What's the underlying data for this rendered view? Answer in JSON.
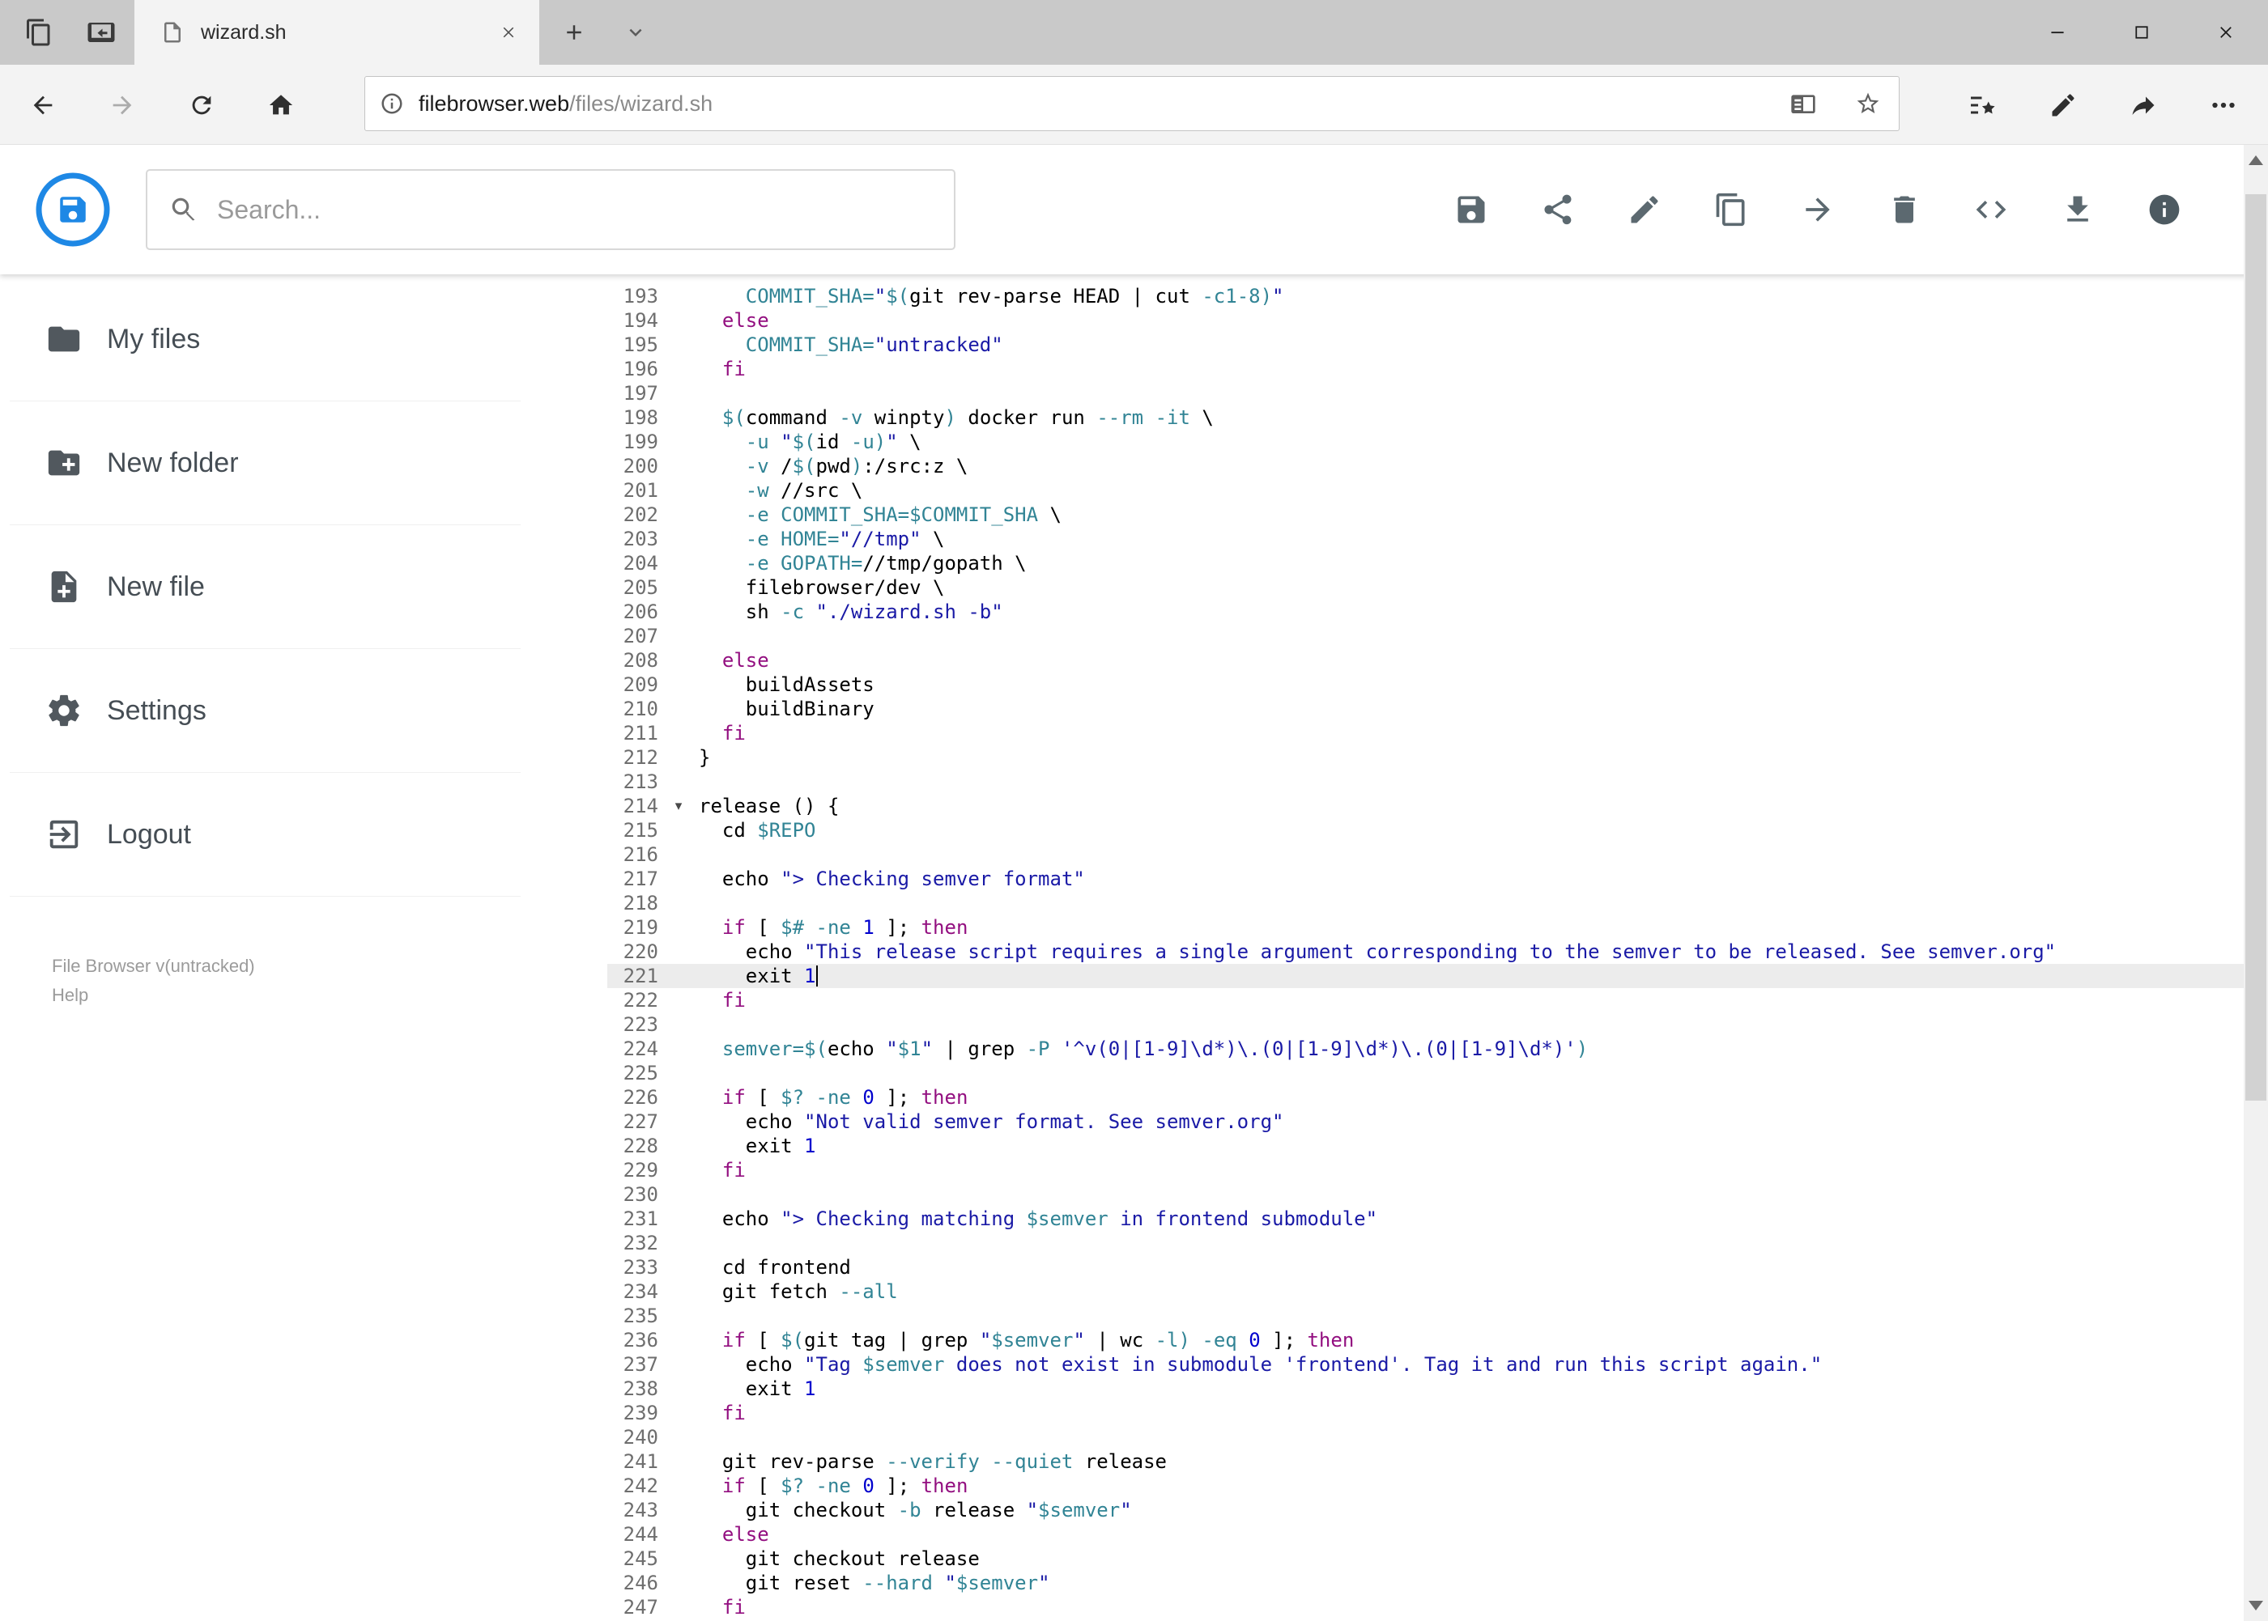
{
  "browser": {
    "tab": {
      "title": "wizard.sh"
    },
    "window_controls": [
      "minimize",
      "maximize",
      "close"
    ],
    "strip_icons": [
      "tabs-aside-icon",
      "tabs-preview-icon",
      "new-tab-icon",
      "tab-list-chevron-icon"
    ],
    "nav_icons": [
      "back-icon",
      "forward-icon",
      "refresh-icon",
      "home-icon"
    ],
    "address": {
      "host": "filebrowser.web",
      "path": "/files/wizard.sh"
    },
    "address_icons": [
      "page-info-icon",
      "reading-view-icon",
      "favorite-star-icon"
    ],
    "hub_icons": [
      "favorites-hub-icon",
      "annotate-pen-icon",
      "share-icon",
      "more-options-icon"
    ]
  },
  "app": {
    "accent_color": "#1e88e5",
    "search": {
      "placeholder": "Search..."
    },
    "toolbar": {
      "icons": [
        "save",
        "share",
        "rename",
        "copy",
        "move",
        "delete",
        "code",
        "download",
        "info"
      ]
    },
    "sidebar": {
      "items": [
        {
          "label": "My files",
          "icon": "folder-icon"
        },
        {
          "label": "New folder",
          "icon": "new-folder-icon"
        },
        {
          "label": "New file",
          "icon": "new-file-icon"
        },
        {
          "label": "Settings",
          "icon": "settings-gear-icon"
        },
        {
          "label": "Logout",
          "icon": "logout-icon"
        }
      ],
      "footer": {
        "version": "File Browser v(untracked)",
        "help": "Help"
      }
    }
  },
  "editor": {
    "first_line": 193,
    "active_line": 221,
    "fold_line": 214,
    "colors": {
      "keyword": "#930F80",
      "string": "#1A1AA6",
      "variable": "#318495",
      "numeric": "#0000CD",
      "default": "#000000"
    },
    "lines": [
      {
        "n": 193,
        "t": [
          [
            "    ",
            "d"
          ],
          [
            "COMMIT_SHA=",
            "v"
          ],
          [
            "\"",
            "s"
          ],
          [
            "$(",
            "v"
          ],
          [
            "git rev-parse HEAD | cut ",
            "d"
          ],
          [
            "-c1-8",
            "v"
          ],
          [
            ")",
            "v"
          ],
          [
            "\"",
            "s"
          ]
        ]
      },
      {
        "n": 194,
        "t": [
          [
            "  ",
            "d"
          ],
          [
            "else",
            "k"
          ]
        ]
      },
      {
        "n": 195,
        "t": [
          [
            "    ",
            "d"
          ],
          [
            "COMMIT_SHA=",
            "v"
          ],
          [
            "\"untracked\"",
            "s"
          ]
        ]
      },
      {
        "n": 196,
        "t": [
          [
            "  ",
            "d"
          ],
          [
            "fi",
            "k"
          ]
        ]
      },
      {
        "n": 197,
        "t": []
      },
      {
        "n": 198,
        "t": [
          [
            "  ",
            "d"
          ],
          [
            "$(",
            "v"
          ],
          [
            "command ",
            "d"
          ],
          [
            "-v",
            "v"
          ],
          [
            " winpty",
            "d"
          ],
          [
            ")",
            "v"
          ],
          [
            " docker run ",
            "d"
          ],
          [
            "--rm",
            "v"
          ],
          [
            " ",
            "d"
          ],
          [
            "-it",
            "v"
          ],
          [
            " \\",
            "d"
          ]
        ]
      },
      {
        "n": 199,
        "t": [
          [
            "    ",
            "d"
          ],
          [
            "-u",
            "v"
          ],
          [
            " ",
            "d"
          ],
          [
            "\"",
            "s"
          ],
          [
            "$(",
            "v"
          ],
          [
            "id ",
            "d"
          ],
          [
            "-u",
            "v"
          ],
          [
            ")",
            "v"
          ],
          [
            "\"",
            "s"
          ],
          [
            " \\",
            "d"
          ]
        ]
      },
      {
        "n": 200,
        "t": [
          [
            "    ",
            "d"
          ],
          [
            "-v",
            "v"
          ],
          [
            " /",
            "d"
          ],
          [
            "$(",
            "v"
          ],
          [
            "pwd",
            "d"
          ],
          [
            ")",
            "v"
          ],
          [
            ":/src:z \\",
            "d"
          ]
        ]
      },
      {
        "n": 201,
        "t": [
          [
            "    ",
            "d"
          ],
          [
            "-w",
            "v"
          ],
          [
            " //src \\",
            "d"
          ]
        ]
      },
      {
        "n": 202,
        "t": [
          [
            "    ",
            "d"
          ],
          [
            "-e",
            "v"
          ],
          [
            " ",
            "d"
          ],
          [
            "COMMIT_SHA=$COMMIT_SHA",
            "v"
          ],
          [
            " \\",
            "d"
          ]
        ]
      },
      {
        "n": 203,
        "t": [
          [
            "    ",
            "d"
          ],
          [
            "-e",
            "v"
          ],
          [
            " ",
            "d"
          ],
          [
            "HOME=",
            "v"
          ],
          [
            "\"//tmp\"",
            "s"
          ],
          [
            " \\",
            "d"
          ]
        ]
      },
      {
        "n": 204,
        "t": [
          [
            "    ",
            "d"
          ],
          [
            "-e",
            "v"
          ],
          [
            " ",
            "d"
          ],
          [
            "GOPATH=",
            "v"
          ],
          [
            "//tmp/gopath \\",
            "d"
          ]
        ]
      },
      {
        "n": 205,
        "t": [
          [
            "    filebrowser/dev \\",
            "d"
          ]
        ]
      },
      {
        "n": 206,
        "t": [
          [
            "    sh ",
            "d"
          ],
          [
            "-c",
            "v"
          ],
          [
            " ",
            "d"
          ],
          [
            "\"./wizard.sh -b\"",
            "s"
          ]
        ]
      },
      {
        "n": 207,
        "t": []
      },
      {
        "n": 208,
        "t": [
          [
            "  ",
            "d"
          ],
          [
            "else",
            "k"
          ]
        ]
      },
      {
        "n": 209,
        "t": [
          [
            "    buildAssets",
            "d"
          ]
        ]
      },
      {
        "n": 210,
        "t": [
          [
            "    buildBinary",
            "d"
          ]
        ]
      },
      {
        "n": 211,
        "t": [
          [
            "  ",
            "d"
          ],
          [
            "fi",
            "k"
          ]
        ]
      },
      {
        "n": 212,
        "t": [
          [
            "}",
            "d"
          ]
        ]
      },
      {
        "n": 213,
        "t": []
      },
      {
        "n": 214,
        "t": [
          [
            "release () {",
            "d"
          ]
        ]
      },
      {
        "n": 215,
        "t": [
          [
            "  cd ",
            "d"
          ],
          [
            "$REPO",
            "v"
          ]
        ]
      },
      {
        "n": 216,
        "t": []
      },
      {
        "n": 217,
        "t": [
          [
            "  echo ",
            "d"
          ],
          [
            "\"> Checking semver format\"",
            "s"
          ]
        ]
      },
      {
        "n": 218,
        "t": []
      },
      {
        "n": 219,
        "t": [
          [
            "  ",
            "d"
          ],
          [
            "if",
            "k"
          ],
          [
            " [ ",
            "d"
          ],
          [
            "$#",
            "v"
          ],
          [
            " ",
            "d"
          ],
          [
            "-ne",
            "v"
          ],
          [
            " ",
            "d"
          ],
          [
            "1",
            "n"
          ],
          [
            " ]; ",
            "d"
          ],
          [
            "then",
            "k"
          ]
        ]
      },
      {
        "n": 220,
        "t": [
          [
            "    echo ",
            "d"
          ],
          [
            "\"This release script requires a single argument corresponding to the semver to be released. See semver.org\"",
            "s"
          ]
        ]
      },
      {
        "n": 221,
        "t": [
          [
            "    exit ",
            "d"
          ],
          [
            "1",
            "n"
          ]
        ]
      },
      {
        "n": 222,
        "t": [
          [
            "  ",
            "d"
          ],
          [
            "fi",
            "k"
          ]
        ]
      },
      {
        "n": 223,
        "t": []
      },
      {
        "n": 224,
        "t": [
          [
            "  ",
            "d"
          ],
          [
            "semver=$(",
            "v"
          ],
          [
            "echo ",
            "d"
          ],
          [
            "\"",
            "s"
          ],
          [
            "$1",
            "v"
          ],
          [
            "\"",
            "s"
          ],
          [
            " | grep ",
            "d"
          ],
          [
            "-P",
            "v"
          ],
          [
            " ",
            "d"
          ],
          [
            "'^v(0|[1-9]\\d*)\\.(0|[1-9]\\d*)\\.(0|[1-9]\\d*)'",
            "s"
          ],
          [
            ")",
            "v"
          ]
        ]
      },
      {
        "n": 225,
        "t": []
      },
      {
        "n": 226,
        "t": [
          [
            "  ",
            "d"
          ],
          [
            "if",
            "k"
          ],
          [
            " [ ",
            "d"
          ],
          [
            "$?",
            "v"
          ],
          [
            " ",
            "d"
          ],
          [
            "-ne",
            "v"
          ],
          [
            " ",
            "d"
          ],
          [
            "0",
            "n"
          ],
          [
            " ]; ",
            "d"
          ],
          [
            "then",
            "k"
          ]
        ]
      },
      {
        "n": 227,
        "t": [
          [
            "    echo ",
            "d"
          ],
          [
            "\"Not valid semver format. See semver.org\"",
            "s"
          ]
        ]
      },
      {
        "n": 228,
        "t": [
          [
            "    exit ",
            "d"
          ],
          [
            "1",
            "n"
          ]
        ]
      },
      {
        "n": 229,
        "t": [
          [
            "  ",
            "d"
          ],
          [
            "fi",
            "k"
          ]
        ]
      },
      {
        "n": 230,
        "t": []
      },
      {
        "n": 231,
        "t": [
          [
            "  echo ",
            "d"
          ],
          [
            "\"> Checking matching ",
            "s"
          ],
          [
            "$semver",
            "v"
          ],
          [
            " in frontend submodule\"",
            "s"
          ]
        ]
      },
      {
        "n": 232,
        "t": []
      },
      {
        "n": 233,
        "t": [
          [
            "  cd frontend",
            "d"
          ]
        ]
      },
      {
        "n": 234,
        "t": [
          [
            "  git fetch ",
            "d"
          ],
          [
            "--all",
            "v"
          ]
        ]
      },
      {
        "n": 235,
        "t": []
      },
      {
        "n": 236,
        "t": [
          [
            "  ",
            "d"
          ],
          [
            "if",
            "k"
          ],
          [
            " [ ",
            "d"
          ],
          [
            "$(",
            "v"
          ],
          [
            "git tag | grep ",
            "d"
          ],
          [
            "\"",
            "s"
          ],
          [
            "$semver",
            "v"
          ],
          [
            "\"",
            "s"
          ],
          [
            " | wc ",
            "d"
          ],
          [
            "-l",
            "v"
          ],
          [
            ")",
            "v"
          ],
          [
            " ",
            "d"
          ],
          [
            "-eq",
            "v"
          ],
          [
            " ",
            "d"
          ],
          [
            "0",
            "n"
          ],
          [
            " ]; ",
            "d"
          ],
          [
            "then",
            "k"
          ]
        ]
      },
      {
        "n": 237,
        "t": [
          [
            "    echo ",
            "d"
          ],
          [
            "\"Tag ",
            "s"
          ],
          [
            "$semver",
            "v"
          ],
          [
            " does not exist in submodule 'frontend'. Tag it and run this script again.\"",
            "s"
          ]
        ]
      },
      {
        "n": 238,
        "t": [
          [
            "    exit ",
            "d"
          ],
          [
            "1",
            "n"
          ]
        ]
      },
      {
        "n": 239,
        "t": [
          [
            "  ",
            "d"
          ],
          [
            "fi",
            "k"
          ]
        ]
      },
      {
        "n": 240,
        "t": []
      },
      {
        "n": 241,
        "t": [
          [
            "  git rev-parse ",
            "d"
          ],
          [
            "--verify",
            "v"
          ],
          [
            " ",
            "d"
          ],
          [
            "--quiet",
            "v"
          ],
          [
            " release",
            "d"
          ]
        ]
      },
      {
        "n": 242,
        "t": [
          [
            "  ",
            "d"
          ],
          [
            "if",
            "k"
          ],
          [
            " [ ",
            "d"
          ],
          [
            "$?",
            "v"
          ],
          [
            " ",
            "d"
          ],
          [
            "-ne",
            "v"
          ],
          [
            " ",
            "d"
          ],
          [
            "0",
            "n"
          ],
          [
            " ]; ",
            "d"
          ],
          [
            "then",
            "k"
          ]
        ]
      },
      {
        "n": 243,
        "t": [
          [
            "    git checkout ",
            "d"
          ],
          [
            "-b",
            "v"
          ],
          [
            " release ",
            "d"
          ],
          [
            "\"",
            "s"
          ],
          [
            "$semver",
            "v"
          ],
          [
            "\"",
            "s"
          ]
        ]
      },
      {
        "n": 244,
        "t": [
          [
            "  ",
            "d"
          ],
          [
            "else",
            "k"
          ]
        ]
      },
      {
        "n": 245,
        "t": [
          [
            "    git checkout release",
            "d"
          ]
        ]
      },
      {
        "n": 246,
        "t": [
          [
            "    git reset ",
            "d"
          ],
          [
            "--hard",
            "v"
          ],
          [
            " ",
            "d"
          ],
          [
            "\"",
            "s"
          ],
          [
            "$semver",
            "v"
          ],
          [
            "\"",
            "s"
          ]
        ]
      },
      {
        "n": 247,
        "t": [
          [
            "  ",
            "d"
          ],
          [
            "fi",
            "k"
          ]
        ]
      }
    ]
  }
}
